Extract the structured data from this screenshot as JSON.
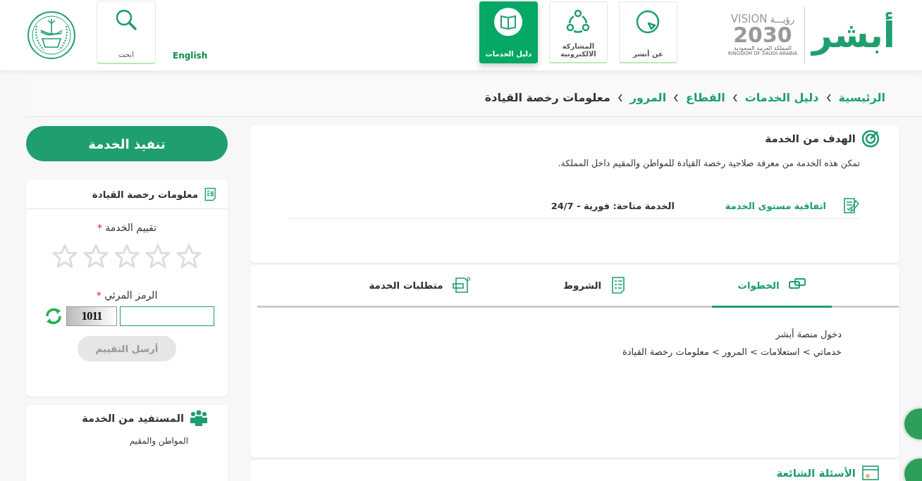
{
  "header": {
    "vision_logo": {
      "arabic": "رؤيـــة",
      "word": "VISION",
      "year": "2030",
      "country_ar": "المملكة العربية السعودية",
      "country_en": "KINGDOM OF SAUDI ARABIA"
    },
    "brand": "أبشر",
    "nav": [
      {
        "label": "عن أبشر",
        "selected": false
      },
      {
        "label": "المشاركة الالكترونية",
        "selected": false
      },
      {
        "label": "دليل الخدمات",
        "selected": true
      }
    ],
    "language": "English",
    "search": "ابحث"
  },
  "breadcrumb": [
    {
      "label": "الرئيسية",
      "current": false
    },
    {
      "label": "دليل الخدمات",
      "current": false
    },
    {
      "label": "القطاع",
      "current": false
    },
    {
      "label": "المرور",
      "current": false
    },
    {
      "label": "معلومات رخصة القيادة",
      "current": true
    }
  ],
  "goal": {
    "title": "الهدف من الخدمة",
    "text": "تمكن هذه الخدمة من معرفة صلاحية رخصة القيادة للمواطن والمقيم داخل المملكة.",
    "sla_label": "اتفاقية مستوى الخدمة",
    "sla_value": "الخدمة متاحة: فورية - 24/7"
  },
  "tabs": [
    {
      "label": "الخطوات",
      "selected": true
    },
    {
      "label": "الشروط",
      "selected": false
    },
    {
      "label": "متطلبات الخدمة",
      "selected": false
    }
  ],
  "steps": [
    "دخول منصة أبشر",
    "خدماتي > استعلامات > المرور > معلومات رخصة القيادة"
  ],
  "faq_title": "الأسئلة الشائعة",
  "execute_button": "تنفيذ الخدمة",
  "rating_card": {
    "title": "معلومات رخصة القيادة",
    "rating_label": "تقييم الخدمة",
    "required_mark": "*",
    "stars": 0,
    "captcha_label": "الرمز المرئي",
    "captcha_text": "1011",
    "submit": "أرسل التقييم",
    "submit_disabled": true
  },
  "beneficiary": {
    "title": "المستفيد من الخدمة",
    "value": "المواطن والمقيم"
  }
}
